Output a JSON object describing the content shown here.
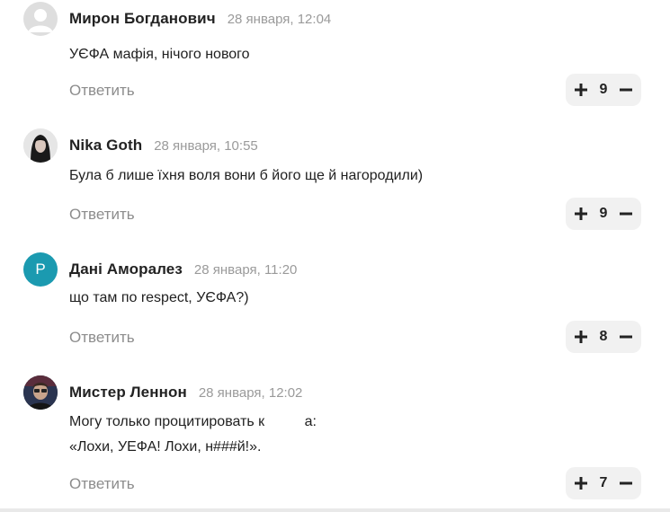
{
  "comments": [
    {
      "author": "Мирон Богданович",
      "date": "28 января, 12:04",
      "avatar_type": "placeholder",
      "text_lines": [
        "УЄФА мафія, нічого нового"
      ],
      "reply_label": "Ответить",
      "votes": "9"
    },
    {
      "author": "Nika Goth",
      "date": "28 января, 10:55",
      "avatar_type": "photo",
      "text_lines": [
        "Була б лише їхня воля вони б його ще й нагородили)"
      ],
      "reply_label": "Ответить",
      "votes": "9"
    },
    {
      "author": "Дані Аморалез",
      "date": "28 января, 11:20",
      "avatar_type": "letter",
      "avatar_letter": "Р",
      "avatar_color": "#1b9ab0",
      "text_lines": [
        "що там по respect, УЄФА?)"
      ],
      "reply_label": "Ответить",
      "votes": "8"
    },
    {
      "author": "Мистер Леннон",
      "date": "28 января, 12:02",
      "avatar_type": "photo",
      "text_lines": [
        "Могу только процитировать к          а:",
        "«Лохи, УЕФА! Лохи, н###й!»."
      ],
      "reply_label": "Ответить",
      "votes": "7"
    }
  ],
  "icons": {
    "upvote": "plus-icon",
    "downvote": "minus-icon"
  }
}
